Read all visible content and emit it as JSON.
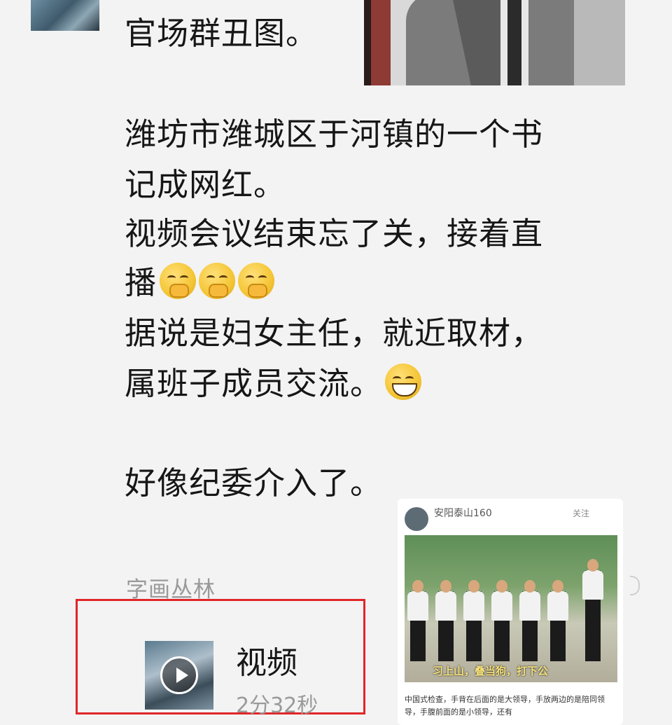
{
  "post": {
    "lines": [
      "官场群丑图。",
      "潍坊市潍城区于河镇的一个书",
      "记成网红。",
      "视频会议结束忘了关，接着直",
      "播",
      "据说是妇女主任，就近取材，",
      "属班子成员交流。",
      "好像纪委介入了。"
    ],
    "emojis": [
      "facepalm-laugh-emoji",
      "facepalm-laugh-emoji",
      "facepalm-laugh-emoji",
      "grin-emoji"
    ],
    "author": "字画丛林"
  },
  "video_card": {
    "title": "视频",
    "duration": "2分32秒",
    "border_color": "#e0262a"
  },
  "shared_post": {
    "account": "安阳泰山160",
    "follow": "关注",
    "overlay_text": "习上山，叠当狗，打下公",
    "caption": "中国式检查，手背在后面的是大领导，手放两边的是陪同领导，手腹前面的是小领导，还有"
  }
}
